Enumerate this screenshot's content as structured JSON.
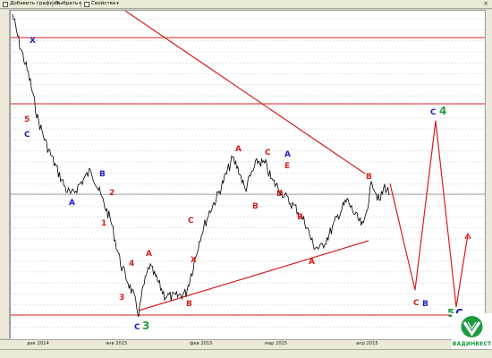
{
  "toolbar": {
    "add_chart_label": "Добавить график",
    "select_label": "Выбрать",
    "properties_label": "Свойства",
    "close_glyph": "×",
    "dropdown_glyph": "▾"
  },
  "x_axis": {
    "labels": [
      "дек 2014",
      "янв 2015",
      "фев 2015",
      "мар 2015",
      "апр 2015"
    ]
  },
  "wave_labels": [
    {
      "text": "X",
      "color": "#1c1ccc"
    },
    {
      "text": "5",
      "color": "#d42020"
    },
    {
      "text": "C",
      "color": "#1c1ccc"
    },
    {
      "text": "A",
      "color": "#1c1ccc"
    },
    {
      "text": "B",
      "color": "#1c1ccc"
    },
    {
      "text": "2",
      "color": "#d42020"
    },
    {
      "text": "1",
      "color": "#d42020"
    },
    {
      "text": "A",
      "color": "#d42020"
    },
    {
      "text": "4",
      "color": "#d42020"
    },
    {
      "text": "3",
      "color": "#d42020"
    },
    {
      "text": "C",
      "color": "#1c1ccc"
    },
    {
      "text": "3",
      "color": "#22a045"
    },
    {
      "text": "B",
      "color": "#d42020"
    },
    {
      "text": "X",
      "color": "#d42020"
    },
    {
      "text": "C",
      "color": "#d42020"
    },
    {
      "text": "A",
      "color": "#d42020"
    },
    {
      "text": "B",
      "color": "#d42020"
    },
    {
      "text": "C",
      "color": "#d42020"
    },
    {
      "text": "A",
      "color": "#1c1ccc"
    },
    {
      "text": "E",
      "color": "#d42020"
    },
    {
      "text": "D",
      "color": "#d42020"
    },
    {
      "text": "B",
      "color": "#d42020"
    },
    {
      "text": "A",
      "color": "#d42020"
    },
    {
      "text": "B",
      "color": "#d42020"
    },
    {
      "text": "C",
      "color": "#1c1ccc"
    },
    {
      "text": "4",
      "color": "#22a045"
    },
    {
      "text": "C",
      "color": "#d42020"
    },
    {
      "text": "B",
      "color": "#1c1ccc"
    },
    {
      "text": "5",
      "color": "#22a045"
    },
    {
      "text": "C",
      "color": "#1c1ccc"
    }
  ],
  "logo": {
    "text": "ВАДИНВЕСТ"
  },
  "colors": {
    "price_line": "#000000",
    "level_lines": "#d42020",
    "trend_lines": "#d42020",
    "grid": "#c8c8c8",
    "wave_green": "#22a045",
    "wave_blue": "#1c1ccc",
    "wave_red": "#d42020"
  }
}
